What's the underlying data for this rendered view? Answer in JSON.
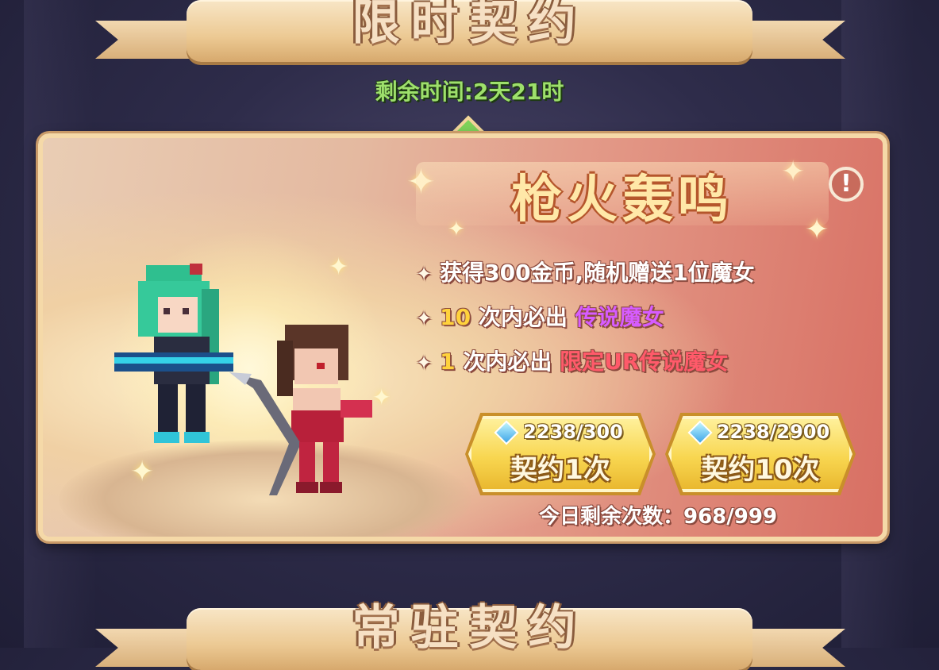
{
  "top_banner": {
    "title": "限时契约"
  },
  "timer": {
    "text": "剩余时间:2天21时"
  },
  "event": {
    "title": "枪火轰鸣",
    "info_icon": "exclamation-icon",
    "rules": [
      {
        "lead": "",
        "text": "获得300金币,随机赠送1位魔女",
        "highlight": ""
      },
      {
        "lead": "10",
        "text": " 次内必出 ",
        "highlight": "传说魔女"
      },
      {
        "lead": "1",
        "text": " 次内必出 ",
        "highlight": "限定UR传说魔女"
      }
    ],
    "buttons": [
      {
        "cost": "2238/300",
        "label": "契约1次",
        "currency_icon": "diamond-icon"
      },
      {
        "cost": "2238/2900",
        "label": "契约10次",
        "currency_icon": "diamond-icon"
      }
    ],
    "remaining": "今日剩余次数：968/999"
  },
  "bottom_banner": {
    "title": "常驻契约"
  },
  "colors": {
    "timer": "#9ee06c",
    "legend": "#d65cff",
    "ur": "#ff5a6a",
    "count": "#ffd23c"
  }
}
